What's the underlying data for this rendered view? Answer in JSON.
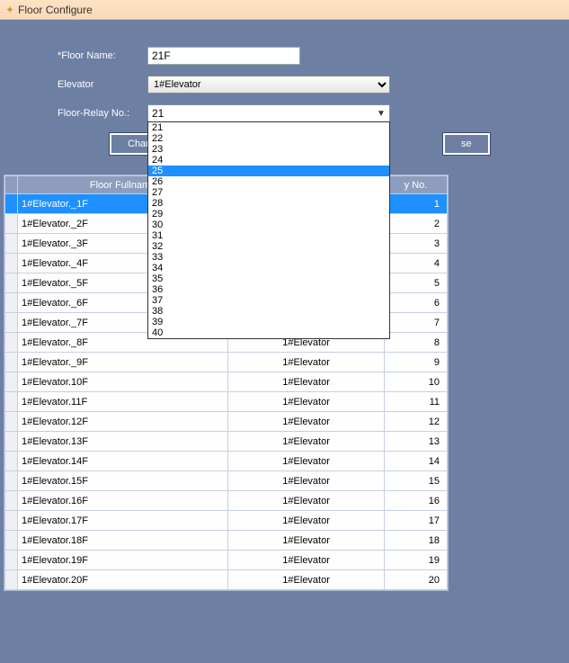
{
  "window": {
    "title": "Floor Configure"
  },
  "form": {
    "floor_name_label": "*Floor Name:",
    "floor_name_value": "21F",
    "elevator_label": "Elevator",
    "elevator_value": "1#Elevator",
    "relay_label": "Floor-Relay No.:",
    "relay_value": "21",
    "relay_options": [
      "21",
      "22",
      "23",
      "24",
      "25",
      "26",
      "27",
      "28",
      "29",
      "30",
      "31",
      "32",
      "33",
      "34",
      "35",
      "36",
      "37",
      "38",
      "39",
      "40"
    ],
    "relay_highlight": "25"
  },
  "buttons": {
    "change_name": "Change Name",
    "close": "se"
  },
  "table": {
    "cols": {
      "fullname": "Floor Fullname",
      "elevator": "",
      "no": "y No."
    },
    "rows": [
      {
        "fullname": "1#Elevator._1F",
        "elev": "",
        "no": "1",
        "sel": true
      },
      {
        "fullname": "1#Elevator._2F",
        "elev": "",
        "no": "2"
      },
      {
        "fullname": "1#Elevator._3F",
        "elev": "",
        "no": "3"
      },
      {
        "fullname": "1#Elevator._4F",
        "elev": "",
        "no": "4"
      },
      {
        "fullname": "1#Elevator._5F",
        "elev": "",
        "no": "5"
      },
      {
        "fullname": "1#Elevator._6F",
        "elev": "",
        "no": "6"
      },
      {
        "fullname": "1#Elevator._7F",
        "elev": "",
        "no": "7"
      },
      {
        "fullname": "1#Elevator._8F",
        "elev": "1#Elevator",
        "no": "8"
      },
      {
        "fullname": "1#Elevator._9F",
        "elev": "1#Elevator",
        "no": "9"
      },
      {
        "fullname": "1#Elevator.10F",
        "elev": "1#Elevator",
        "no": "10"
      },
      {
        "fullname": "1#Elevator.11F",
        "elev": "1#Elevator",
        "no": "11"
      },
      {
        "fullname": "1#Elevator.12F",
        "elev": "1#Elevator",
        "no": "12"
      },
      {
        "fullname": "1#Elevator.13F",
        "elev": "1#Elevator",
        "no": "13"
      },
      {
        "fullname": "1#Elevator.14F",
        "elev": "1#Elevator",
        "no": "14"
      },
      {
        "fullname": "1#Elevator.15F",
        "elev": "1#Elevator",
        "no": "15"
      },
      {
        "fullname": "1#Elevator.16F",
        "elev": "1#Elevator",
        "no": "16"
      },
      {
        "fullname": "1#Elevator.17F",
        "elev": "1#Elevator",
        "no": "17"
      },
      {
        "fullname": "1#Elevator.18F",
        "elev": "1#Elevator",
        "no": "18"
      },
      {
        "fullname": "1#Elevator.19F",
        "elev": "1#Elevator",
        "no": "19"
      },
      {
        "fullname": "1#Elevator.20F",
        "elev": "1#Elevator",
        "no": "20"
      }
    ]
  }
}
